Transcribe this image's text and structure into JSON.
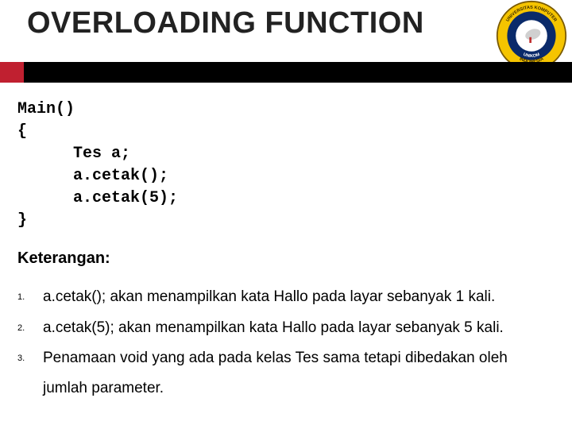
{
  "title": "OVERLOADING FUNCTION",
  "logo": {
    "outer_ring_top": "UNIVERSITAS KOMPUTER",
    "outer_ring_bottom": "INDONESIA",
    "inner_ring": "UNIKOM"
  },
  "code": {
    "l1": "Main()",
    "l2": "{",
    "l3": "Tes a;",
    "l4": "a.cetak();",
    "l5": "a.cetak(5);",
    "l6": "}"
  },
  "keterangan_label": "Keterangan:",
  "items": [
    {
      "n": "1.",
      "t": "a.cetak(); akan menampilkan kata Hallo pada layar sebanyak 1 kali."
    },
    {
      "n": "2.",
      "t": "a.cetak(5); akan menampilkan kata Hallo pada layar sebanyak 5 kali."
    },
    {
      "n": "3.",
      "t": "Penamaan void yang ada pada kelas Tes sama tetapi dibedakan oleh jumlah parameter."
    }
  ]
}
